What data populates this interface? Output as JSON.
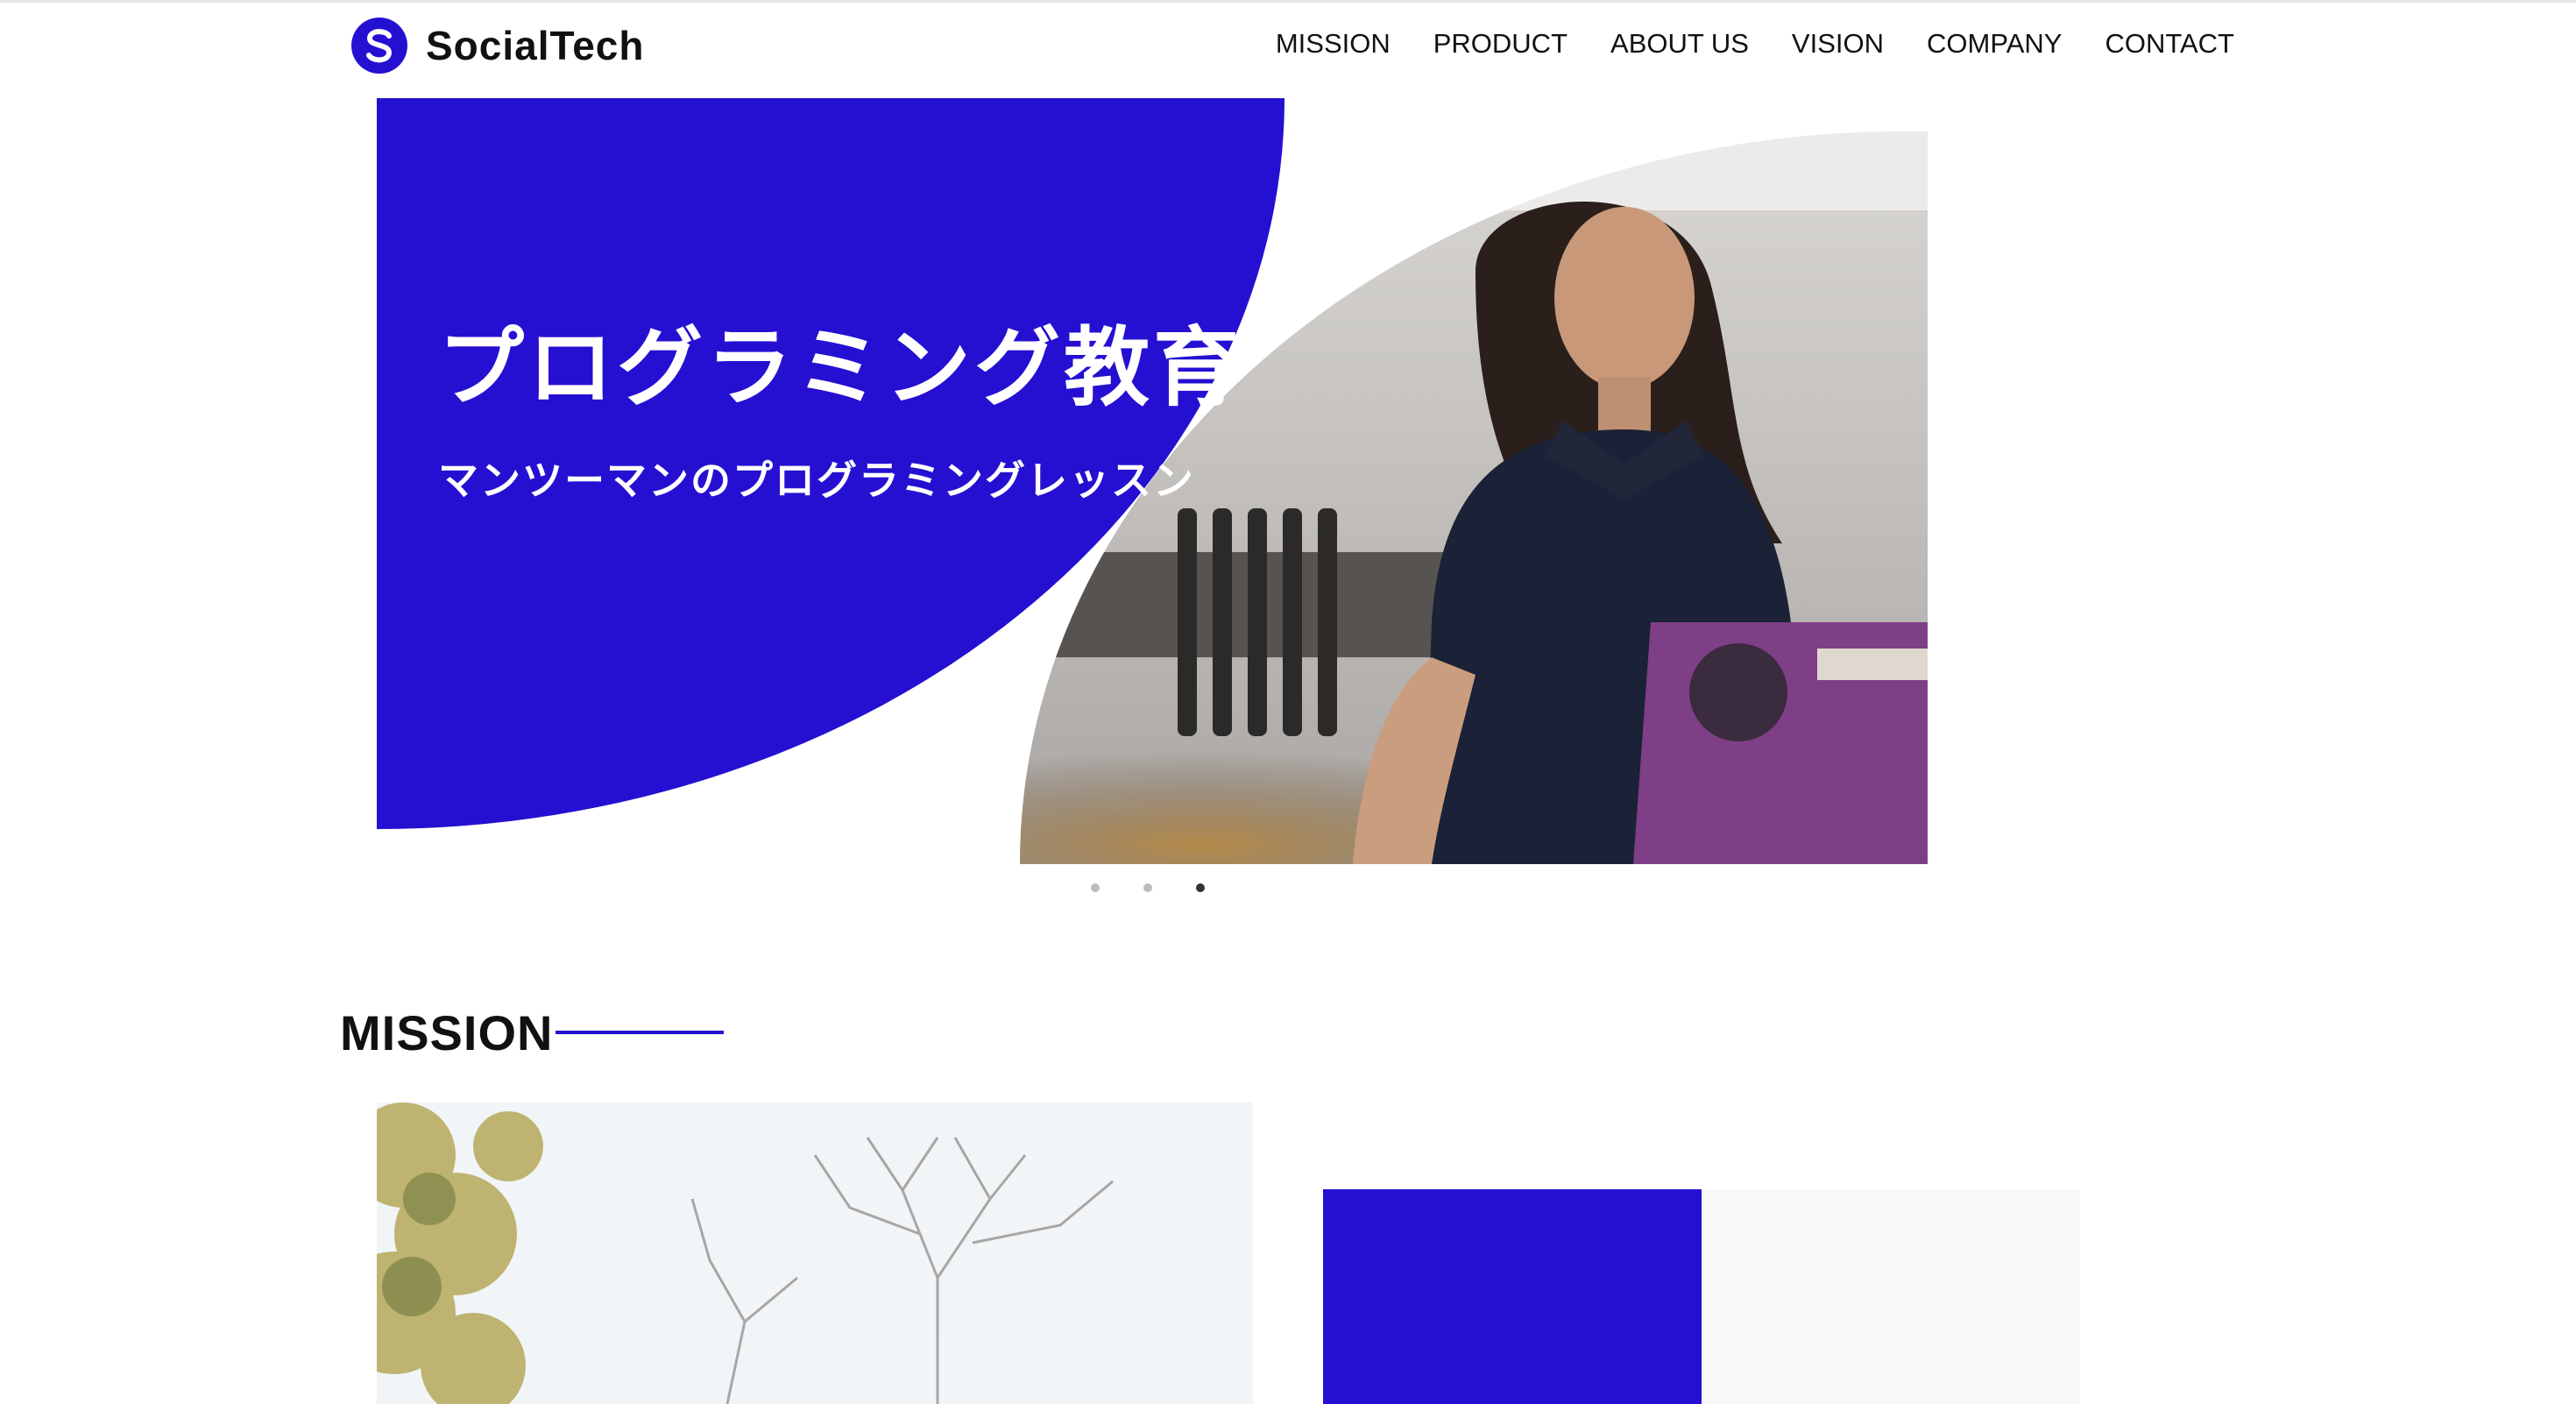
{
  "brand": {
    "name": "SocialTech",
    "logo_letter": "S",
    "accent": "#2510d2"
  },
  "nav": {
    "items": [
      {
        "label": "MISSION"
      },
      {
        "label": "PRODUCT"
      },
      {
        "label": "ABOUT US"
      },
      {
        "label": "VISION"
      },
      {
        "label": "COMPANY"
      },
      {
        "label": "CONTACT"
      }
    ]
  },
  "hero": {
    "title": "プログラミング教育",
    "subtitle": "マンツーマンのプログラミングレッスン",
    "photo": "woman-with-laptop-photo",
    "slides": 3,
    "active_slide": 3
  },
  "mission": {
    "title": "MISSION",
    "photo": "tree-branches-photo"
  }
}
